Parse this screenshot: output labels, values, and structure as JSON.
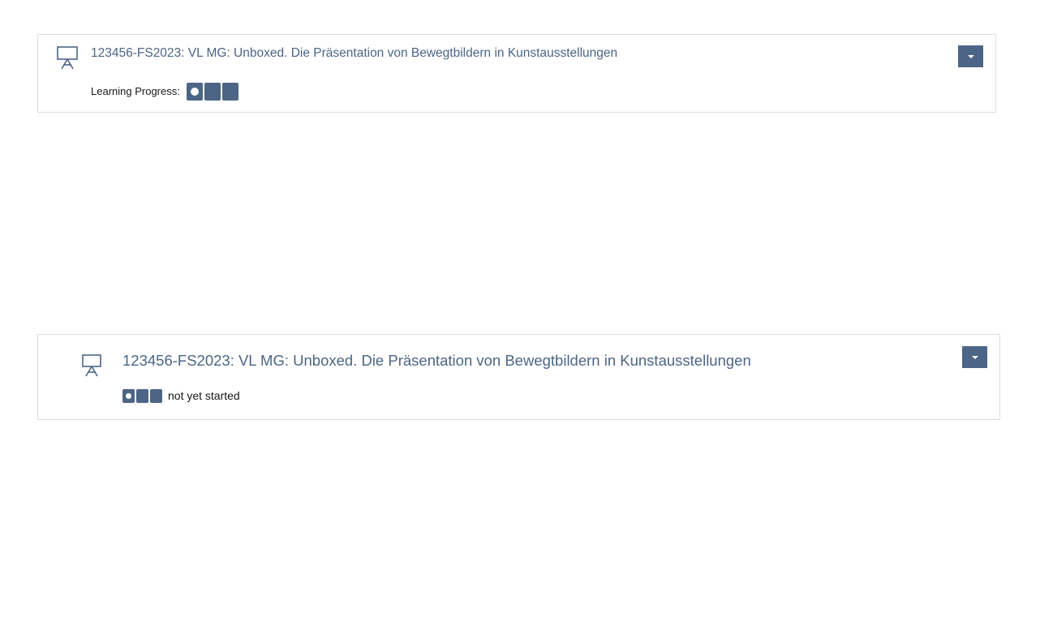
{
  "colors": {
    "accent": "#4c6586",
    "card_border": "#dddddd",
    "text": "#161616"
  },
  "item_1": {
    "icon": "presentation-board-icon",
    "title": "123456-FS2023: VL MG: Unboxed. Die Präsentation von Bewegtbildern in Kunstausstellungen",
    "learning_progress_label": "Learning Progress:",
    "progress": {
      "steps_total": 3,
      "steps_done": 0
    },
    "actions_icon": "chevron-down-icon"
  },
  "item_2": {
    "icon": "presentation-board-icon",
    "title": "123456-FS2023: VL MG: Unboxed. Die Präsentation von Bewegtbildern in Kunstausstellungen",
    "progress": {
      "steps_total": 3,
      "steps_done": 0
    },
    "progress_status": "not yet started",
    "actions_icon": "chevron-down-icon"
  }
}
